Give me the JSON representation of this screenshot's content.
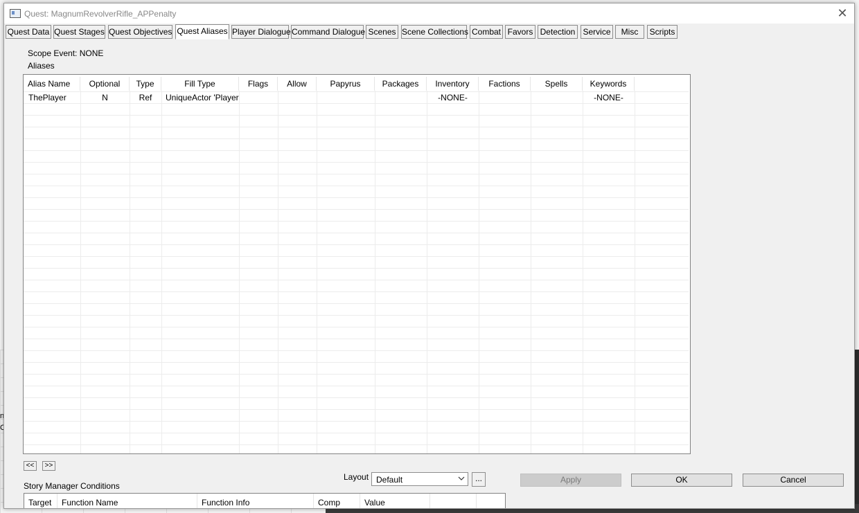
{
  "window": {
    "title": "Quest: MagnumRevolverRifle_APPenalty",
    "close_glyph": "✕"
  },
  "tabs": [
    {
      "label": "Quest Data"
    },
    {
      "label": "Quest Stages"
    },
    {
      "label": "Quest Objectives"
    },
    {
      "label": "Quest Aliases",
      "active": true
    },
    {
      "label": "Player Dialogue"
    },
    {
      "label": "Command Dialogue"
    },
    {
      "label": "Scenes"
    },
    {
      "label": "Scene Collections"
    },
    {
      "label": "Combat"
    },
    {
      "label": "Favors"
    },
    {
      "label": "Detection"
    },
    {
      "label": "Service"
    },
    {
      "label": "Misc"
    },
    {
      "label": "Scripts"
    }
  ],
  "scope_event": "Scope Event: NONE",
  "aliases_label": "Aliases",
  "aliases_table": {
    "columns": [
      "Alias Name",
      "Optional",
      "Type",
      "Fill Type",
      "Flags",
      "Allow",
      "Papyrus",
      "Packages",
      "Inventory",
      "Factions",
      "Spells",
      "Keywords"
    ],
    "rows": [
      [
        "ThePlayer",
        "N",
        "Ref",
        "UniqueActor 'Player'",
        "",
        "",
        "",
        "",
        "-NONE-",
        "",
        "",
        "-NONE-"
      ]
    ]
  },
  "nav": {
    "prev": "<<",
    "next": ">>"
  },
  "layout": {
    "label": "Layout",
    "value": "Default",
    "more": "..."
  },
  "buttons": {
    "apply": "Apply",
    "ok": "OK",
    "cancel": "Cancel"
  },
  "story_manager": {
    "label": "Story Manager Conditions",
    "columns": [
      "Target",
      "Function Name",
      "Function Info",
      "Comp",
      "Value",
      "",
      ""
    ]
  },
  "background_fragments": [
    "n",
    "C"
  ]
}
